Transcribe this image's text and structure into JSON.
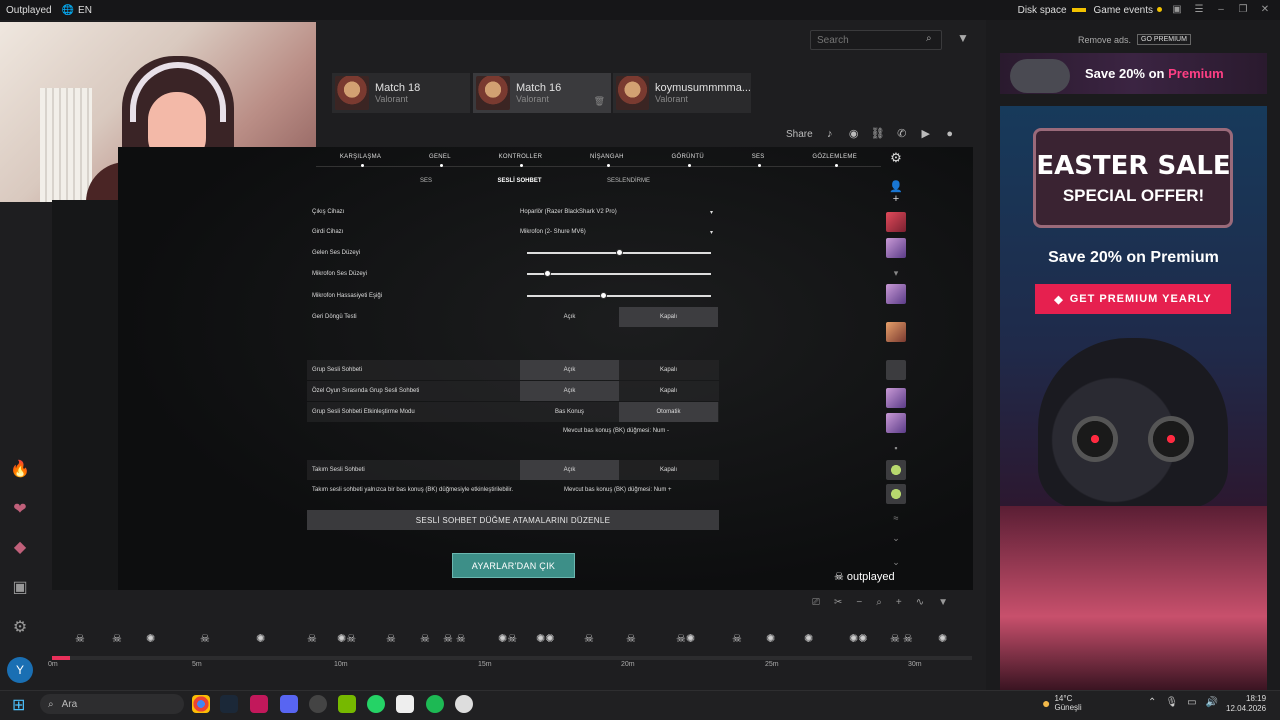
{
  "titlebar": {
    "brand": "Outplayed",
    "lang": "EN",
    "disk_space": "Disk space",
    "game_events": "Game events"
  },
  "search": {
    "placeholder": "Search"
  },
  "matches": [
    {
      "title": "Match 18",
      "game": "Valorant"
    },
    {
      "title": "Match 16",
      "game": "Valorant"
    },
    {
      "title": "koymusummmma...",
      "game": "Valorant"
    }
  ],
  "share": {
    "label": "Share"
  },
  "settings": {
    "tabs": [
      "KARŞILAŞMA",
      "GENEL",
      "KONTROLLER",
      "NİŞANGAH",
      "GÖRÜNTÜ",
      "SES",
      "GÖZLEMLEME"
    ],
    "subtabs": [
      "SES",
      "SESLİ SOHBET",
      "SESLENDİRME"
    ],
    "output_device": {
      "label": "Çıkış Cihazı",
      "value": "Hoparlör (Razer BlackShark V2 Pro)"
    },
    "input_device": {
      "label": "Girdi Cihazı",
      "value": "Mikrofon (2- Shure MV6)"
    },
    "incoming_volume": {
      "label": "Gelen Ses Düzeyi",
      "level": 0.49
    },
    "mic_volume": {
      "label": "Mikrofon Ses Düzeyi",
      "level": 0.1
    },
    "mic_threshold": {
      "label": "Mikrofon Hassasiyeti Eşiği",
      "level": 0.4
    },
    "loopback": {
      "label": "Geri Döngü Testi",
      "on": "Açık",
      "off": "Kapalı"
    },
    "group_voice": {
      "label": "Grup Sesli Sohbeti",
      "on": "Açık",
      "off": "Kapalı"
    },
    "custom_group_voice": {
      "label": "Özel Oyun Sırasında Grup Sesli Sohbeti",
      "on": "Açık",
      "off": "Kapalı"
    },
    "group_voice_mode": {
      "label": "Grup Sesli Sohbeti Etkinleştirme Modu",
      "ptt": "Bas Konuş",
      "auto": "Otomatik"
    },
    "group_ptt_note": "Mevcut bas konuş (BK) düğmesi: Num -",
    "team_voice": {
      "label": "Takım Sesli Sohbeti",
      "on": "Açık",
      "off": "Kapalı"
    },
    "team_note": "Takım sesli sohbeti yalnızca bir bas konuş (BK) düğmesiyle etkinleştirilebilir.",
    "team_ptt_note": "Mevcut bas konuş (BK) düğmesi: Num +",
    "edit_button": "SESLİ SOHBET DÜĞME ATAMALARINI DÜZENLE",
    "exit_button": "AYARLAR'DAN ÇIK"
  },
  "watermark": "outplayed",
  "timeline": {
    "ticks": [
      "0m",
      "5m",
      "10m",
      "15m",
      "20m",
      "25m",
      "30m"
    ],
    "progress": 0.02
  },
  "ads": {
    "remove": "Remove ads.",
    "go_premium": "GO PREMIUM",
    "banner_text": "Save 20% on ",
    "banner_highlight": "Premium",
    "sale_line1": "EASTER SALE",
    "sale_line2": "SPECIAL OFFER!",
    "save_text": "Save 20% on Premium",
    "cta": "GET PREMIUM YEARLY"
  },
  "taskbar": {
    "search": "Ara",
    "temp": "14°C",
    "weather": "Güneşli",
    "time": "18:19",
    "date": "12.04.2026"
  },
  "colors": {
    "accent": "#e6204f",
    "teal": "#3d8f88",
    "yellow": "#f2c200"
  }
}
